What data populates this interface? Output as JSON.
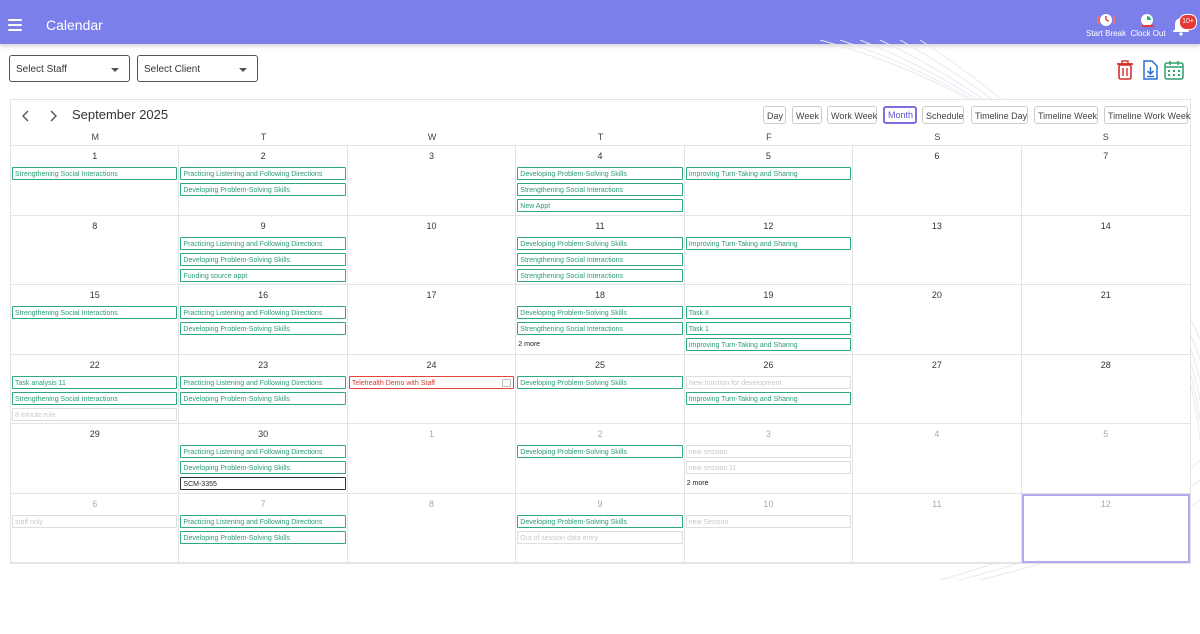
{
  "header": {
    "title": "Calendar",
    "start_break": "Start Break",
    "clock_out": "Clock Out",
    "notification_count": "10+"
  },
  "filters": {
    "staff_placeholder": "Select Staff",
    "client_placeholder": "Select Client"
  },
  "toolbar_icons": [
    "delete-icon",
    "download-icon",
    "calendar-icon"
  ],
  "calendar": {
    "month_label": "September 2025",
    "views": [
      "Day",
      "Week",
      "Work Week",
      "Month",
      "Schedule",
      "Timeline Day",
      "Timeline Week",
      "Timeline Work Week"
    ],
    "active_view": "Month",
    "weekdays": [
      "M",
      "T",
      "W",
      "T",
      "F",
      "S",
      "S"
    ],
    "weeks": [
      [
        {
          "day": "1",
          "current": true,
          "events": [
            {
              "title": "Strengthening Social Interactions",
              "style": "green"
            }
          ]
        },
        {
          "day": "2",
          "current": true,
          "events": [
            {
              "title": "Practicing Listening and Following Directions",
              "style": "green"
            },
            {
              "title": "Developing Problem-Solving Skills",
              "style": "green"
            }
          ]
        },
        {
          "day": "3",
          "current": true,
          "events": []
        },
        {
          "day": "4",
          "current": true,
          "events": [
            {
              "title": "Developing Problem-Solving Skills",
              "style": "green"
            },
            {
              "title": "Strengthening Social Interactions",
              "style": "green"
            },
            {
              "title": "New Appt",
              "style": "green"
            }
          ]
        },
        {
          "day": "5",
          "current": true,
          "events": [
            {
              "title": "Improving Turn-Taking and Sharing",
              "style": "green"
            }
          ]
        },
        {
          "day": "6",
          "current": true,
          "events": []
        },
        {
          "day": "7",
          "current": true,
          "events": []
        }
      ],
      [
        {
          "day": "8",
          "current": true,
          "events": []
        },
        {
          "day": "9",
          "current": true,
          "events": [
            {
              "title": "Practicing Listening and Following Directions",
              "style": "green"
            },
            {
              "title": "Developing Problem-Solving Skills",
              "style": "green"
            },
            {
              "title": "Funding source appt",
              "style": "green"
            }
          ]
        },
        {
          "day": "10",
          "current": true,
          "events": []
        },
        {
          "day": "11",
          "current": true,
          "events": [
            {
              "title": "Developing Problem-Solving Skills",
              "style": "green"
            },
            {
              "title": "Strengthening Social Interactions",
              "style": "green"
            },
            {
              "title": "Strengthening Social Interactions",
              "style": "green"
            }
          ]
        },
        {
          "day": "12",
          "current": true,
          "events": [
            {
              "title": "Improving Turn-Taking and Sharing",
              "style": "green"
            }
          ]
        },
        {
          "day": "13",
          "current": true,
          "events": []
        },
        {
          "day": "14",
          "current": true,
          "events": []
        }
      ],
      [
        {
          "day": "15",
          "current": true,
          "events": [
            {
              "title": "Strengthening Social Interactions",
              "style": "green"
            }
          ]
        },
        {
          "day": "16",
          "current": true,
          "events": [
            {
              "title": "Practicing Listening and Following Directions",
              "style": "green"
            },
            {
              "title": "Developing Problem-Solving Skills",
              "style": "green"
            }
          ]
        },
        {
          "day": "17",
          "current": true,
          "events": []
        },
        {
          "day": "18",
          "current": true,
          "events": [
            {
              "title": "Developing Problem-Solving Skills",
              "style": "green"
            },
            {
              "title": "Strengthening Social Interactions",
              "style": "green"
            }
          ],
          "more": "2 more"
        },
        {
          "day": "19",
          "current": true,
          "events": [
            {
              "title": "Task II",
              "style": "green"
            },
            {
              "title": "Task 1",
              "style": "green"
            },
            {
              "title": "Improving Turn-Taking and Sharing",
              "style": "green"
            }
          ]
        },
        {
          "day": "20",
          "current": true,
          "events": []
        },
        {
          "day": "21",
          "current": true,
          "events": []
        }
      ],
      [
        {
          "day": "22",
          "current": true,
          "events": [
            {
              "title": "Task analysis 11",
              "style": "green"
            },
            {
              "title": "Strengthening Social Interactions",
              "style": "green"
            },
            {
              "title": "8 minute rule",
              "style": "faded"
            }
          ]
        },
        {
          "day": "23",
          "current": true,
          "events": [
            {
              "title": "Practicing Listening and Following Directions",
              "style": "green"
            },
            {
              "title": "Developing Problem-Solving Skills",
              "style": "green"
            }
          ]
        },
        {
          "day": "24",
          "current": true,
          "events": [
            {
              "title": "Telehealth Demo with Staff",
              "style": "red",
              "telehealth": true
            }
          ]
        },
        {
          "day": "25",
          "current": true,
          "events": [
            {
              "title": "Developing Problem-Solving Skills",
              "style": "green"
            }
          ]
        },
        {
          "day": "26",
          "current": true,
          "events": [
            {
              "title": "New function for development",
              "style": "faded"
            },
            {
              "title": "Improving Turn-Taking and Sharing",
              "style": "green"
            }
          ]
        },
        {
          "day": "27",
          "current": true,
          "events": []
        },
        {
          "day": "28",
          "current": true,
          "events": []
        }
      ],
      [
        {
          "day": "29",
          "current": true,
          "events": []
        },
        {
          "day": "30",
          "current": true,
          "events": [
            {
              "title": "Practicing Listening and Following Directions",
              "style": "green"
            },
            {
              "title": "Developing Problem-Solving Skills",
              "style": "green"
            },
            {
              "title": "SCM-3355",
              "style": "black"
            }
          ]
        },
        {
          "day": "1",
          "current": false,
          "events": []
        },
        {
          "day": "2",
          "current": false,
          "events": [
            {
              "title": "Developing Problem-Solving Skills",
              "style": "green"
            }
          ]
        },
        {
          "day": "3",
          "current": false,
          "events": [
            {
              "title": "new session",
              "style": "faded"
            },
            {
              "title": "new session 11",
              "style": "faded"
            }
          ],
          "more": "2 more"
        },
        {
          "day": "4",
          "current": false,
          "events": []
        },
        {
          "day": "5",
          "current": false,
          "events": []
        }
      ],
      [
        {
          "day": "6",
          "current": false,
          "events": [
            {
              "title": "staff only",
              "style": "faded"
            }
          ]
        },
        {
          "day": "7",
          "current": false,
          "events": [
            {
              "title": "Practicing Listening and Following Directions",
              "style": "green"
            },
            {
              "title": "Developing Problem-Solving Skills",
              "style": "green"
            }
          ]
        },
        {
          "day": "8",
          "current": false,
          "events": []
        },
        {
          "day": "9",
          "current": false,
          "events": [
            {
              "title": "Developing Problem-Solving Skills",
              "style": "green"
            },
            {
              "title": "Out of session data entry",
              "style": "faded"
            }
          ]
        },
        {
          "day": "10",
          "current": false,
          "events": [
            {
              "title": "new Session",
              "style": "faded"
            }
          ]
        },
        {
          "day": "11",
          "current": false,
          "events": []
        },
        {
          "day": "12",
          "current": false,
          "events": [],
          "selected": true
        }
      ]
    ]
  }
}
